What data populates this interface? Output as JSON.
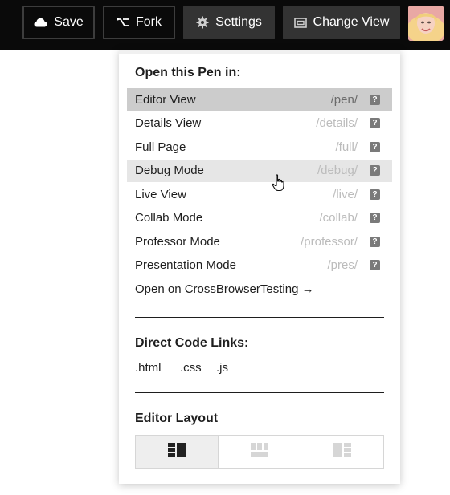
{
  "topbar": {
    "save_label": "Save",
    "fork_label": "Fork",
    "settings_label": "Settings",
    "change_view_label": "Change View"
  },
  "dropdown": {
    "open_title": "Open this Pen in:",
    "views": [
      {
        "label": "Editor View",
        "path": "/pen/",
        "state": "active"
      },
      {
        "label": "Details View",
        "path": "/details/",
        "state": "normal"
      },
      {
        "label": "Full Page",
        "path": "/full/",
        "state": "normal"
      },
      {
        "label": "Debug Mode",
        "path": "/debug/",
        "state": "hover"
      },
      {
        "label": "Live View",
        "path": "/live/",
        "state": "normal"
      },
      {
        "label": "Collab Mode",
        "path": "/collab/",
        "state": "normal"
      },
      {
        "label": "Professor Mode",
        "path": "/professor/",
        "state": "normal"
      },
      {
        "label": "Presentation Mode",
        "path": "/pres/",
        "state": "normal"
      }
    ],
    "help_glyph": "?",
    "crossbrowser_label": "Open on CrossBrowserTesting →",
    "code_links_title": "Direct Code Links:",
    "code_links": [
      ".html",
      ".css",
      ".js"
    ],
    "layout_title": "Editor Layout",
    "layout_options": [
      "layout-left-icon",
      "layout-top-icon",
      "layout-right-icon"
    ],
    "active_layout": 0
  },
  "icons": {
    "save": "cloud-icon",
    "fork": "fork-icon",
    "settings": "gear-icon",
    "change_view": "window-icon",
    "cursor": "hand-pointer-icon"
  },
  "colors": {
    "topbar_bg": "#0a0a0a",
    "active_row": "#cccccc",
    "hover_row": "#e6e6e6",
    "muted_path": "#bcbcbc"
  }
}
